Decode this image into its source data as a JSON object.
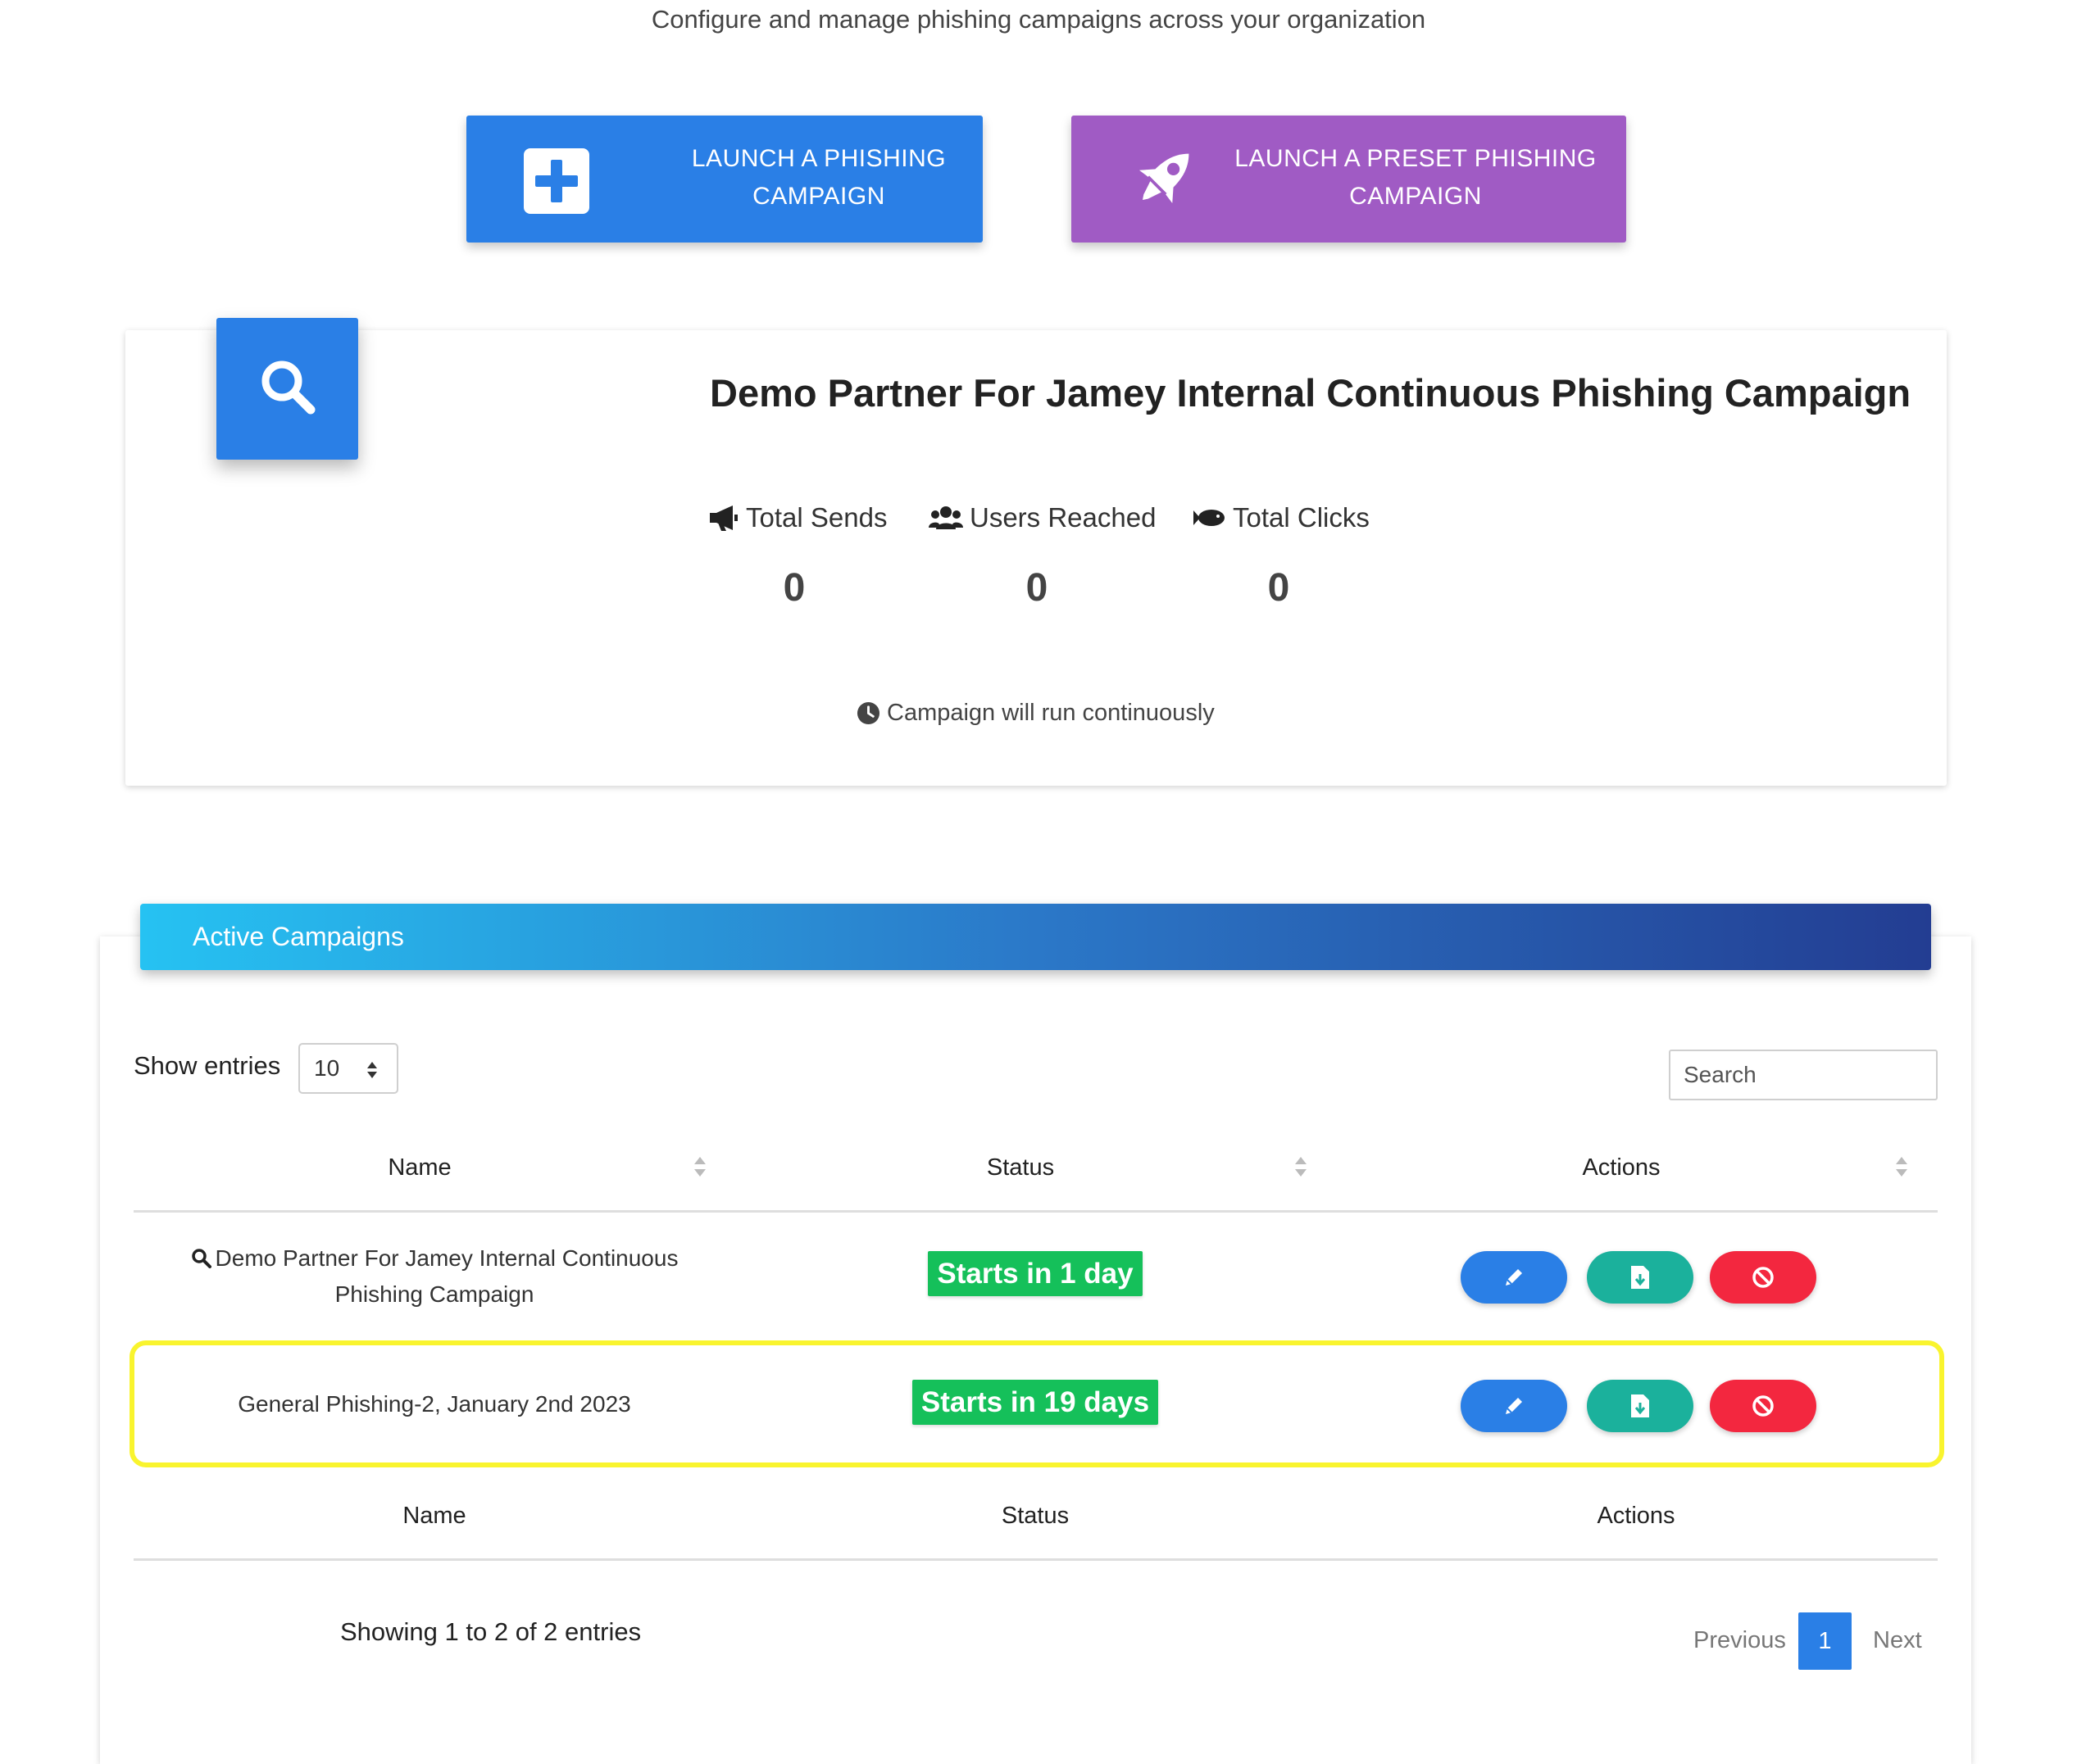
{
  "header": {
    "subtitle": "Configure and manage phishing campaigns across your organization"
  },
  "launch_buttons": {
    "phishing": {
      "label": "LAUNCH A PHISHING\nCAMPAIGN",
      "icon": "plus-square-icon",
      "color": "#2a7fe6"
    },
    "preset": {
      "label": "LAUNCH A PRESET PHISHING\nCAMPAIGN",
      "icon": "rocket-icon",
      "color": "#a05bc4"
    }
  },
  "summary": {
    "icon": "search-icon",
    "title": "Demo Partner For Jamey Internal Continuous Phishing Campaign",
    "stats": [
      {
        "icon": "megaphone-icon",
        "label": "Total Sends",
        "value": "0"
      },
      {
        "icon": "users-icon",
        "label": "Users Reached",
        "value": "0"
      },
      {
        "icon": "fish-icon",
        "label": "Total Clicks",
        "value": "0"
      }
    ],
    "run_note": "Campaign will run continuously",
    "run_note_icon": "clock-icon"
  },
  "active_campaigns": {
    "header": "Active Campaigns",
    "show_entries_label": "Show entries",
    "entries_value": "10",
    "search_placeholder": "Search",
    "columns": [
      "Name",
      "Status",
      "Actions"
    ],
    "rows": [
      {
        "name": "Demo Partner For Jamey Internal Continuous\nPhishing Campaign",
        "name_icon": "search-icon",
        "status": "Starts in 1 day"
      },
      {
        "name": "General Phishing-2, January 2nd 2023",
        "status": "Starts in 19 days"
      }
    ],
    "action_icons": [
      "pencil-icon",
      "file-download-icon",
      "ban-icon"
    ],
    "footer_columns": [
      "Name",
      "Status",
      "Actions"
    ],
    "info": "Showing 1 to 2 of 2 entries",
    "pagination": {
      "previous": "Previous",
      "current": "1",
      "next": "Next"
    }
  },
  "colors": {
    "primary": "#2a7fe6",
    "purple": "#a05bc4",
    "success": "#15c05a",
    "teal": "#1bb19c",
    "danger": "#f3273f",
    "highlight": "#f9f42e"
  }
}
